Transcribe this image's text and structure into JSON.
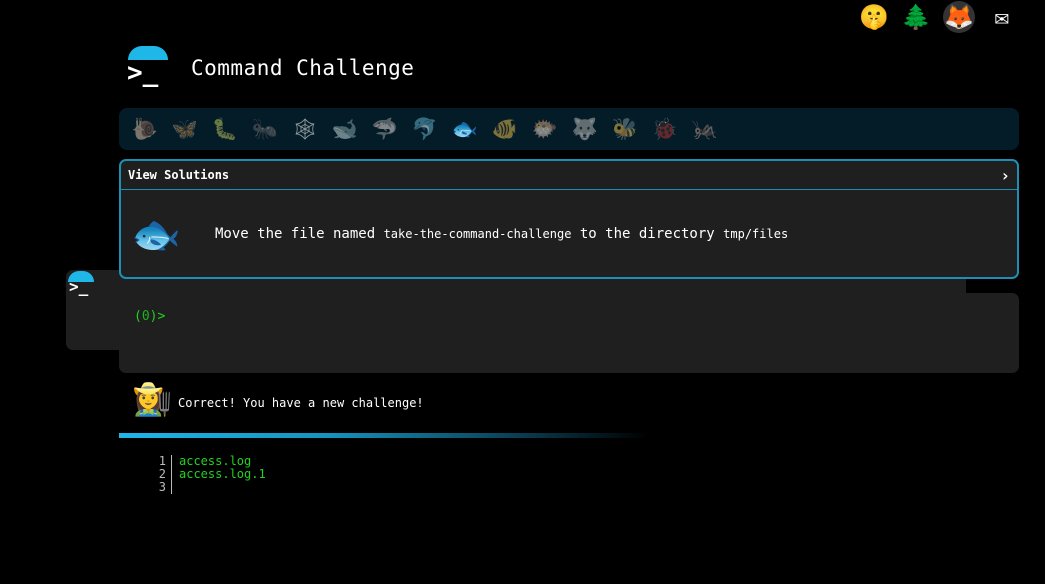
{
  "top_icons": [
    {
      "name": "terminal-icon",
      "glyph": ""
    },
    {
      "name": "shush-icon",
      "glyph": "🤫"
    },
    {
      "name": "tree-icon",
      "glyph": "🌲"
    },
    {
      "name": "gitlab-icon",
      "glyph": "🦊"
    },
    {
      "name": "mail-icon",
      "glyph": "✉"
    }
  ],
  "header": {
    "title": "Command Challenge",
    "logo_glyph": ">_"
  },
  "animals": [
    {
      "name": "snail",
      "glyph": "🐌",
      "active": false
    },
    {
      "name": "butterfly",
      "glyph": "🦋",
      "active": false
    },
    {
      "name": "caterpillar",
      "glyph": "🐛",
      "active": false
    },
    {
      "name": "ant",
      "glyph": "🐜",
      "active": false
    },
    {
      "name": "spider-web",
      "glyph": "🕸",
      "active": false
    },
    {
      "name": "whale",
      "glyph": "🐋",
      "active": false
    },
    {
      "name": "shark",
      "glyph": "🦈",
      "active": false
    },
    {
      "name": "dolphin",
      "glyph": "🐬",
      "active": false
    },
    {
      "name": "fish",
      "glyph": "🐟",
      "active": true
    },
    {
      "name": "tropical-fish",
      "glyph": "🐠",
      "active": false
    },
    {
      "name": "blowfish",
      "glyph": "🐡",
      "active": false
    },
    {
      "name": "wolf",
      "glyph": "🐺",
      "active": false
    },
    {
      "name": "bee",
      "glyph": "🐝",
      "active": false
    },
    {
      "name": "ladybug",
      "glyph": "🐞",
      "active": false
    },
    {
      "name": "worm",
      "glyph": "🦗",
      "active": false
    }
  ],
  "challenge": {
    "view_solutions": "View Solutions",
    "chevron": "›",
    "icon_glyph": "🐟",
    "text_part1": "Move the file named ",
    "code1": "take-the-command-challenge",
    "text_part2": " to the directory ",
    "code2": "tmp/files"
  },
  "terminal": {
    "prompt_open": "(",
    "prompt_zero": "0",
    "prompt_close": ")>"
  },
  "response": {
    "avatar_glyph": "👩‍🌾",
    "message": "Correct! You have a new challenge!"
  },
  "listing": [
    {
      "num": "1",
      "value": "access.log"
    },
    {
      "num": "2",
      "value": "access.log.1"
    },
    {
      "num": "3",
      "value": ""
    }
  ]
}
